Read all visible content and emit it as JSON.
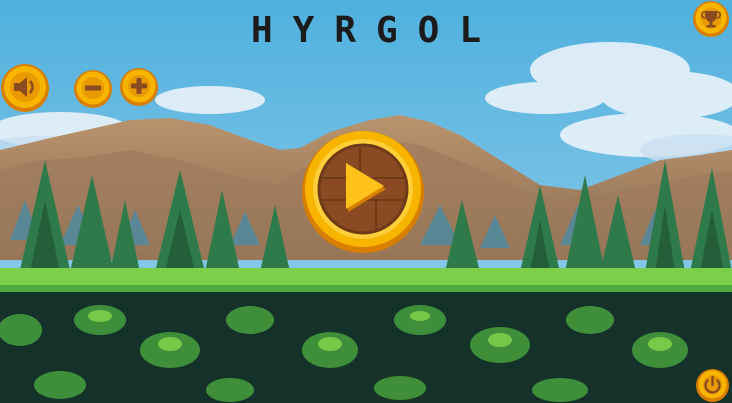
{
  "game": {
    "title": "HYRGOL"
  },
  "controls": {
    "sound_icon": "speaker-icon",
    "zoom_out_icon": "minus-icon",
    "zoom_in_icon": "plus-icon",
    "trophy_icon": "trophy-icon",
    "play_icon": "play-icon",
    "power_icon": "power-icon"
  },
  "colors": {
    "sky": "#5bb6e0",
    "gold": "#f7b500",
    "gold_rim": "#d87e00",
    "wood": "#8a4b22",
    "title": "#1b1b1b"
  }
}
